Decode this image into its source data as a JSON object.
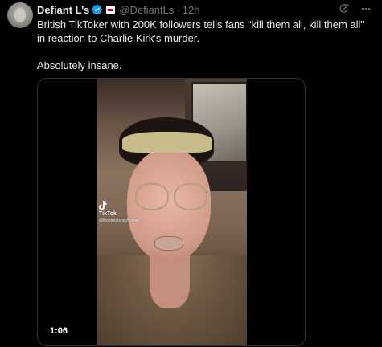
{
  "tweet": {
    "author": {
      "display_name": "Defiant L’s",
      "handle": "@DefiantLs",
      "verified": true,
      "verified_color": "#1d9bf0"
    },
    "separator": "·",
    "timestamp": "12h",
    "text_lines": [
      "British TikToker with 200K followers tells fans “kill them all, kill them all” in reaction to Charlie Kirk’s murder.",
      "Absolutely insane."
    ],
    "media": {
      "type": "video",
      "duration": "1:06",
      "watermark_brand": "TikTok",
      "watermark_user": "@thestreetsmryfsayss"
    },
    "actions": {
      "grok_icon": "grok-icon",
      "more_icon": "more-icon"
    }
  }
}
